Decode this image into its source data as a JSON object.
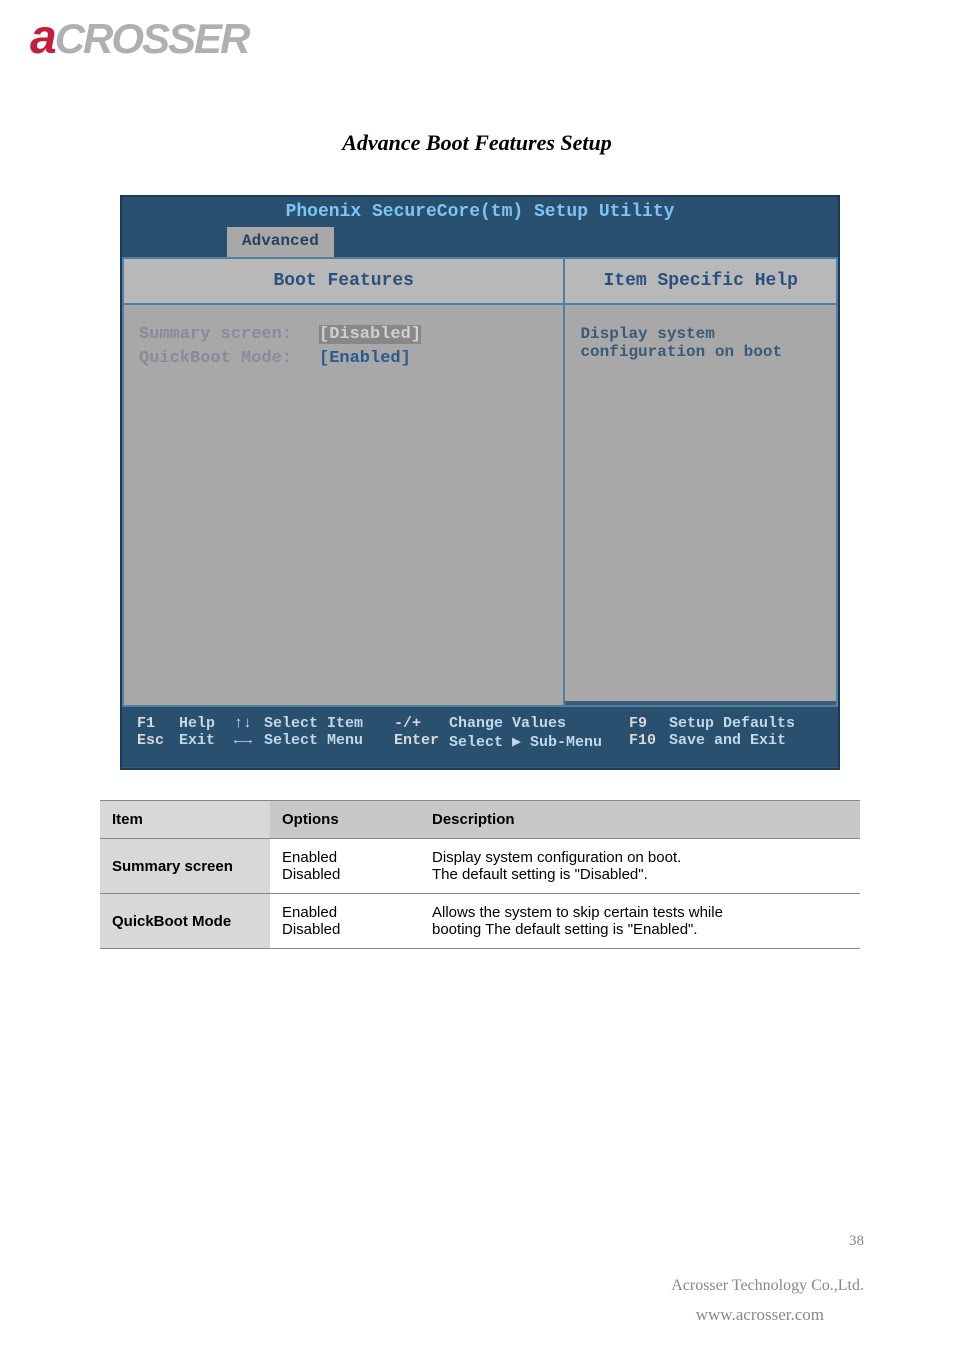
{
  "logo": {
    "red_letter": "a",
    "gray_text": "CROSSER"
  },
  "page_title": "Advance Boot Features Setup",
  "bios": {
    "title": "Phoenix SecureCore(tm) Setup Utility",
    "active_tab": "Advanced",
    "main_header": "Boot Features",
    "help_header": "Item Specific Help",
    "settings": [
      {
        "label": "Summary screen:",
        "value": "[Disabled]",
        "highlighted": true
      },
      {
        "label": "QuickBoot Mode:",
        "value": "[Enabled]",
        "highlighted": false
      }
    ],
    "help_text_line1": "Display system",
    "help_text_line2": "configuration on boot",
    "footer": {
      "row1": {
        "k1": "F1",
        "l1": "Help",
        "arrow": "↑↓",
        "action1": "Select Item",
        "k2": "-/+",
        "action2": "Change Values",
        "k3": "F9",
        "action3": "Setup Defaults"
      },
      "row2": {
        "k1": "Esc",
        "l1": "Exit",
        "arrow": "←→",
        "action1": "Select Menu",
        "k2": "Enter",
        "action2": "Select ▶ Sub-Menu",
        "k3": "F10",
        "action3": "Save and Exit"
      }
    }
  },
  "table": {
    "headers": {
      "item": "Item",
      "options": "Options",
      "desc": "Description"
    },
    "rows": [
      {
        "item": "Summary screen",
        "options_line1": "Enabled",
        "options_line2": "Disabled",
        "desc_line1": "Display system configuration on boot.",
        "desc_line2": "The default setting is \"Disabled\"."
      },
      {
        "item": "QuickBoot Mode",
        "options_line1": "Enabled",
        "options_line2": "Disabled",
        "desc_line1": "Allows the system to skip certain tests while",
        "desc_line2": "booting The default setting is \"Enabled\"."
      }
    ]
  },
  "page_number": "38",
  "footer_company": "Acrosser Technology Co.,Ltd.",
  "footer_url": "www.acrosser.com"
}
